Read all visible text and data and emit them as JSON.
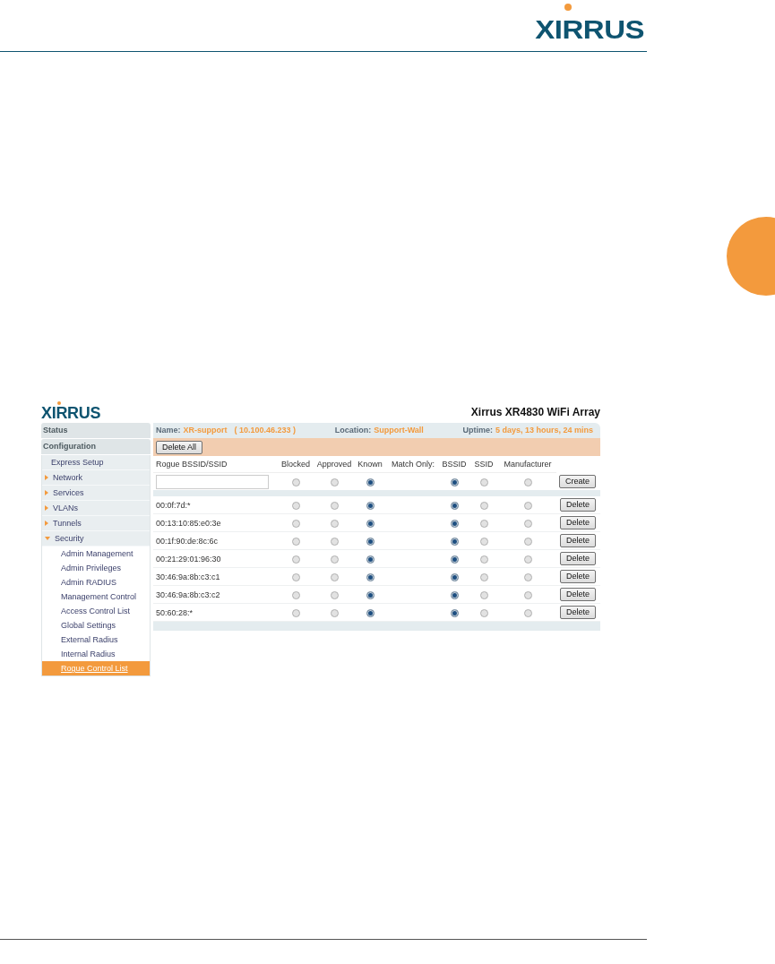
{
  "page_header": {
    "logo": "XIRRUS"
  },
  "screenshot": {
    "logo": "XIRRUS",
    "title": "Xirrus XR4830 WiFi Array",
    "sidebar": {
      "sections": [
        {
          "label": "Status"
        },
        {
          "label": "Configuration"
        }
      ],
      "items": [
        {
          "label": "Express Setup",
          "kind": "link",
          "selected": false
        },
        {
          "label": "Network",
          "kind": "group",
          "expanded": false,
          "selected": false
        },
        {
          "label": "Services",
          "kind": "group",
          "expanded": false,
          "selected": false
        },
        {
          "label": "VLANs",
          "kind": "group",
          "expanded": false,
          "selected": false
        },
        {
          "label": "Tunnels",
          "kind": "group",
          "expanded": false,
          "selected": false
        },
        {
          "label": "Security",
          "kind": "group",
          "expanded": true,
          "selected": false,
          "children": [
            {
              "label": "Admin Management",
              "selected": false
            },
            {
              "label": "Admin Privileges",
              "selected": false
            },
            {
              "label": "Admin RADIUS",
              "selected": false
            },
            {
              "label": "Management Control",
              "selected": false
            },
            {
              "label": "Access Control List",
              "selected": false
            },
            {
              "label": "Global Settings",
              "selected": false
            },
            {
              "label": "External Radius",
              "selected": false
            },
            {
              "label": "Internal Radius",
              "selected": false
            },
            {
              "label": "Rogue Control List",
              "selected": true
            }
          ]
        }
      ]
    },
    "info_bar": {
      "name_label": "Name:",
      "name": "XR-support",
      "ip": "( 10.100.46.233 )",
      "location_label": "Location:",
      "location": "Support-Wall",
      "uptime_label": "Uptime:",
      "uptime": "5 days, 13 hours, 24 mins"
    },
    "toolbar": {
      "delete_all": "Delete All"
    },
    "columns": [
      "Rogue BSSID/SSID",
      "Blocked",
      "Approved",
      "Known",
      "Match Only:",
      "BSSID",
      "SSID",
      "Manufacturer"
    ],
    "new_entry": {
      "classification": [
        {
          "selected": false
        },
        {
          "selected": false
        },
        {
          "selected": true
        }
      ],
      "match_only": [
        {
          "selected": true
        },
        {
          "selected": false
        },
        {
          "selected": false
        }
      ],
      "button": "Create"
    },
    "rows": [
      {
        "address": "00:0f:7d:*",
        "classification": [
          {
            "selected": false
          },
          {
            "selected": false
          },
          {
            "selected": true
          }
        ],
        "match_only": [
          {
            "selected": true
          },
          {
            "selected": false
          },
          {
            "selected": false
          }
        ],
        "button": "Delete"
      },
      {
        "address": "00:13:10:85:e0:3e",
        "classification": [
          {
            "selected": false
          },
          {
            "selected": false
          },
          {
            "selected": true
          }
        ],
        "match_only": [
          {
            "selected": true
          },
          {
            "selected": false
          },
          {
            "selected": false
          }
        ],
        "button": "Delete"
      },
      {
        "address": "00:1f:90:de:8c:6c",
        "classification": [
          {
            "selected": false
          },
          {
            "selected": false
          },
          {
            "selected": true
          }
        ],
        "match_only": [
          {
            "selected": true
          },
          {
            "selected": false
          },
          {
            "selected": false
          }
        ],
        "button": "Delete"
      },
      {
        "address": "00:21:29:01:96:30",
        "classification": [
          {
            "selected": false
          },
          {
            "selected": false
          },
          {
            "selected": true
          }
        ],
        "match_only": [
          {
            "selected": true
          },
          {
            "selected": false
          },
          {
            "selected": false
          }
        ],
        "button": "Delete"
      },
      {
        "address": "30:46:9a:8b:c3:c1",
        "classification": [
          {
            "selected": false
          },
          {
            "selected": false
          },
          {
            "selected": true
          }
        ],
        "match_only": [
          {
            "selected": true
          },
          {
            "selected": false
          },
          {
            "selected": false
          }
        ],
        "button": "Delete"
      },
      {
        "address": "30:46:9a:8b:c3:c2",
        "classification": [
          {
            "selected": false
          },
          {
            "selected": false
          },
          {
            "selected": true
          }
        ],
        "match_only": [
          {
            "selected": true
          },
          {
            "selected": false
          },
          {
            "selected": false
          }
        ],
        "button": "Delete"
      },
      {
        "address": "50:60:28:*",
        "classification": [
          {
            "selected": false
          },
          {
            "selected": false
          },
          {
            "selected": true
          }
        ],
        "match_only": [
          {
            "selected": true
          },
          {
            "selected": false
          },
          {
            "selected": false
          }
        ],
        "button": "Delete"
      }
    ]
  }
}
